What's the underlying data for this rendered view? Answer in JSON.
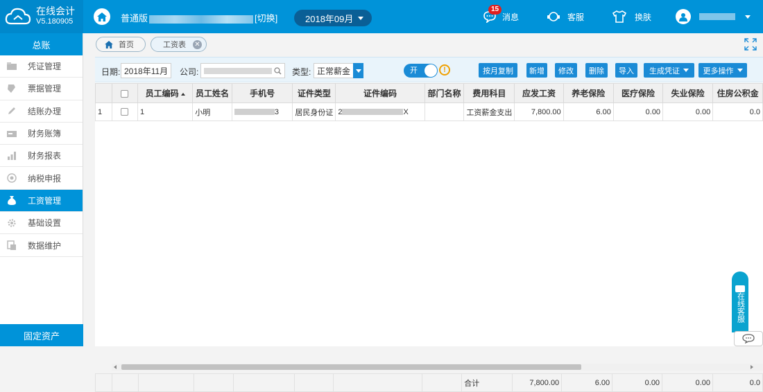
{
  "app": {
    "name": "在线会计",
    "version": "V5.180905"
  },
  "topbar": {
    "edition": "普通版",
    "switch_label": "[切换]",
    "period": "2018年09月",
    "messages_label": "消息",
    "messages_count": "15",
    "service_label": "客服",
    "skin_label": "换肤"
  },
  "sidebar": {
    "title": "总账",
    "items": [
      {
        "label": "凭证管理",
        "icon": "voucher-icon"
      },
      {
        "label": "票据管理",
        "icon": "bill-icon"
      },
      {
        "label": "结账办理",
        "icon": "pen-icon"
      },
      {
        "label": "财务账簿",
        "icon": "book-icon"
      },
      {
        "label": "财务报表",
        "icon": "bar-chart-icon"
      },
      {
        "label": "纳税申报",
        "icon": "tax-icon"
      },
      {
        "label": "工资管理",
        "icon": "money-bag-icon"
      },
      {
        "label": "基础设置",
        "icon": "gear-icon"
      },
      {
        "label": "数据维护",
        "icon": "database-icon"
      }
    ],
    "active_index": 6,
    "bottom": "固定资产"
  },
  "tabs": {
    "home": "首页",
    "current": "工资表"
  },
  "filter": {
    "date_label": "日期:",
    "date_value": "2018年11月",
    "company_label": "公司:",
    "type_label": "类型:",
    "type_value": "正常薪金",
    "toggle_label": "开"
  },
  "actions": {
    "copy_month": "按月复制",
    "add": "新增",
    "edit": "修改",
    "delete": "删除",
    "import": "导入",
    "gen_voucher": "生成凭证",
    "more": "更多操作"
  },
  "table": {
    "headers": [
      "员工编码",
      "员工姓名",
      "手机号",
      "证件类型",
      "证件编码",
      "部门名称",
      "费用科目",
      "应发工资",
      "养老保险",
      "医疗保险",
      "失业保险",
      "住房公积金"
    ],
    "rows": [
      {
        "index": "1",
        "code": "1",
        "name": "小明",
        "phone_suffix": "3",
        "id_type": "居民身份证",
        "id_prefix": "2",
        "id_suffix": "X",
        "dept": "",
        "expense": "工资薪金支出",
        "gross": "7,800.00",
        "pension": "6.00",
        "medical": "0.00",
        "unemployment": "0.00",
        "housing": "0.0"
      }
    ],
    "footer": {
      "label": "合计",
      "gross": "7,800.00",
      "pension": "6.00",
      "medical": "0.00",
      "unemployment": "0.00",
      "housing": "0.0"
    }
  },
  "chat": {
    "label": "在线客服"
  },
  "colors": {
    "primary": "#0093d9",
    "button": "#1a8bd6",
    "warning": "#f0a000",
    "badge": "#e02020"
  }
}
